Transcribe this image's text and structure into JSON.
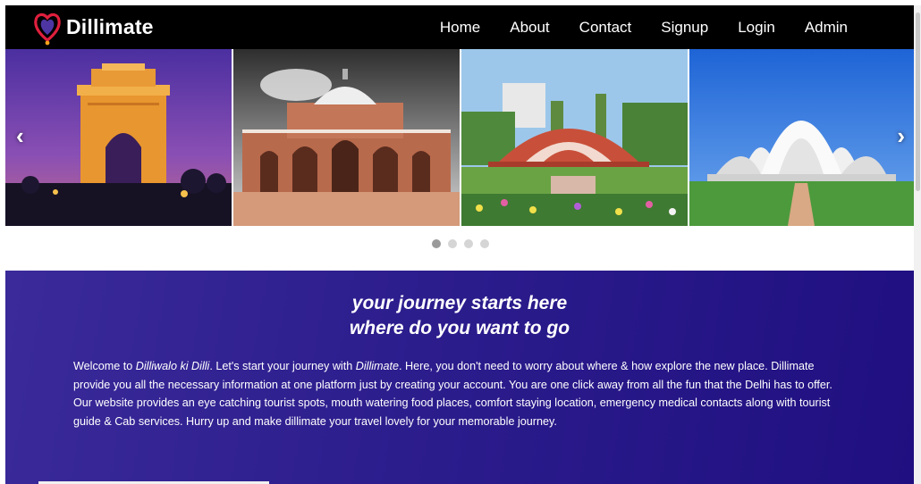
{
  "brand": {
    "name": "Dillimate",
    "logo_icon": "heart-pin-logo"
  },
  "nav": {
    "items": [
      "Home",
      "About",
      "Contact",
      "Signup",
      "Login",
      "Admin"
    ]
  },
  "carousel": {
    "slides": [
      {
        "subject": "India Gate"
      },
      {
        "subject": "Humayun's Tomb"
      },
      {
        "subject": "Jantar Mantar"
      },
      {
        "subject": "Lotus Temple"
      }
    ],
    "prev_glyph": "‹",
    "next_glyph": "›",
    "indicator_count": 4,
    "active_index": 0
  },
  "hero": {
    "title_line1": "your journey starts here",
    "title_line2": "where do you want to go",
    "intro_prefix": "Welcome to ",
    "intro_em1": "Dilliwalo ki Dilli",
    "intro_mid": ". Let's start your journey with ",
    "intro_em2": "Dillimate",
    "intro_rest": ". Here, you don't need to worry about where & how explore the new place. Dillimate provide you all the necessary information at one platform just by creating your account. You are one click away from all the fun that the Delhi has to offer. Our website provides an eye catching tourist spots, mouth watering food places, comfort staying location, emergency medical contacts along with tourist guide & Cab services. Hurry up and make dillimate your travel lovely for your memorable journey."
  },
  "colors": {
    "navbar_bg": "#000000",
    "hero_gradient_start": "#3a2a9a",
    "hero_gradient_end": "#1f0f80",
    "logo_red": "#e01f3d"
  }
}
